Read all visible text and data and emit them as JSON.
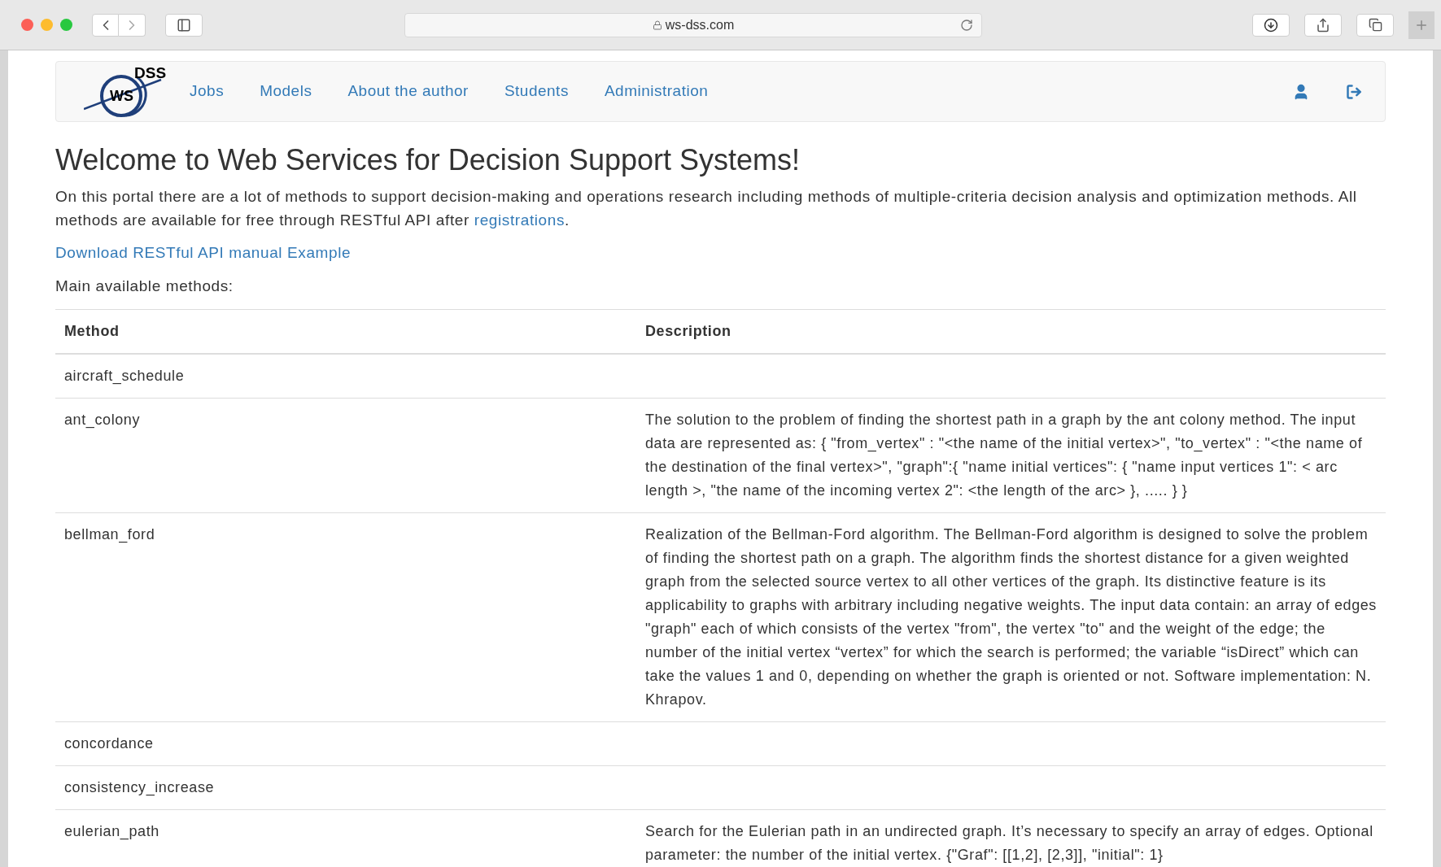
{
  "browser": {
    "address": "ws-dss.com"
  },
  "logo": {
    "main": "WS",
    "sup": "DSS"
  },
  "nav": {
    "items": [
      {
        "label": "Jobs"
      },
      {
        "label": "Models"
      },
      {
        "label": "About the author"
      },
      {
        "label": "Students"
      },
      {
        "label": "Administration"
      }
    ]
  },
  "heading": "Welcome to Web Services for Decision Support Systems!",
  "intro": {
    "text": "On this portal there are a lot of methods to support decision-making and operations research including methods of multiple-criteria decision analysis and optimization methods. All methods are available for free through RESTful API after",
    "link": "registrations",
    "end": "."
  },
  "download_link": "Download RESTful API manual Example",
  "methods_label": "Main available methods:",
  "table": {
    "columns": [
      "Method",
      "Description"
    ],
    "rows": [
      {
        "method": "aircraft_schedule"
      },
      {
        "method": "ant_colony",
        "description": "The solution to the problem of finding the shortest path in a graph by the ant colony method. The input data are represented as: { \"from_vertex\" : \"<the name of the initial vertex>\", \"to_vertex\" : \"<the name of the destination of the final vertex>\", \"graph\":{ \"name initial vertices\": { \"name input vertices 1\": < arc length >, \"the name of the incoming vertex 2\": <the length of the arc> }, ..... } }"
      },
      {
        "method": "bellman_ford",
        "description": "Realization of the Bellman-Ford algorithm. The Bellman-Ford algorithm is designed to solve the problem of finding the shortest path on a graph. The algorithm finds the shortest distance for a given weighted graph from the selected source vertex to all other vertices of the graph. Its distinctive feature is its applicability to graphs with arbitrary including negative weights. The input data contain: an array of edges \"graph\" each of which consists of the vertex \"from\", the vertex \"to\" and the weight of the edge; the number of the initial vertex “vertex” for which the search is performed; the variable “isDirect” which can take the values 1 and 0, depending on whether the graph is oriented or not. Software implementation: N. Khrapov."
      },
      {
        "method": "concordance"
      },
      {
        "method": "consistency_increase"
      },
      {
        "method": "eulerian_path",
        "description": "Search for the Eulerian path in an undirected graph. It’s necessary to specify an array of edges. Optional parameter: the number of the initial vertex. {\"Graf\": [[1,2], [2,3]], \"initial\": 1}"
      }
    ]
  }
}
